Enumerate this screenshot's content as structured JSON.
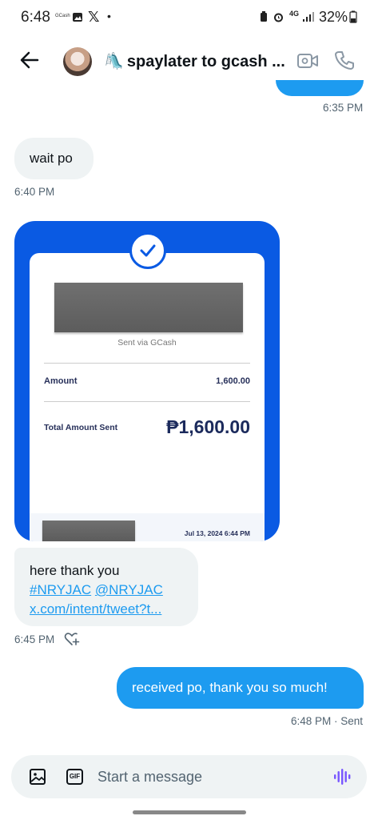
{
  "status_bar": {
    "time": "6:48",
    "gcash_label": "GCash",
    "network": "4G",
    "battery": "32%"
  },
  "header": {
    "title_emoji": "🛝",
    "title": "spaylater to gcash ...",
    "icons": [
      "back-arrow-icon",
      "video-icon",
      "phone-icon"
    ]
  },
  "messages": [
    {
      "direction": "out",
      "time": "6:35 PM"
    },
    {
      "direction": "in",
      "text": "wait po",
      "time": "6:40 PM"
    },
    {
      "direction": "in",
      "type": "image",
      "receipt": {
        "sent_via": "Sent via GCash",
        "amount_label": "Amount",
        "amount_value": "1,600.00",
        "total_label": "Total Amount Sent",
        "total_value": "₱1,600.00",
        "date": "Jul 13, 2024 6:44 PM",
        "brand_color": "#0a5ae3"
      }
    },
    {
      "direction": "in",
      "line1": "here thank you",
      "tag1": "#NRYJAC",
      "tag2": "@NRYJAC",
      "link": "x.com/intent/tweet?t...",
      "time": "6:45 PM"
    },
    {
      "direction": "out",
      "text": "received po, thank you so much!",
      "time": "6:48 PM · Sent"
    }
  ],
  "composer": {
    "placeholder": "Start a message",
    "icons": [
      "image-icon",
      "gif-icon",
      "voice-icon"
    ]
  },
  "colors": {
    "accent": "#1d9bf0",
    "bubble_in": "#eff3f4",
    "timestamp": "#536471"
  }
}
